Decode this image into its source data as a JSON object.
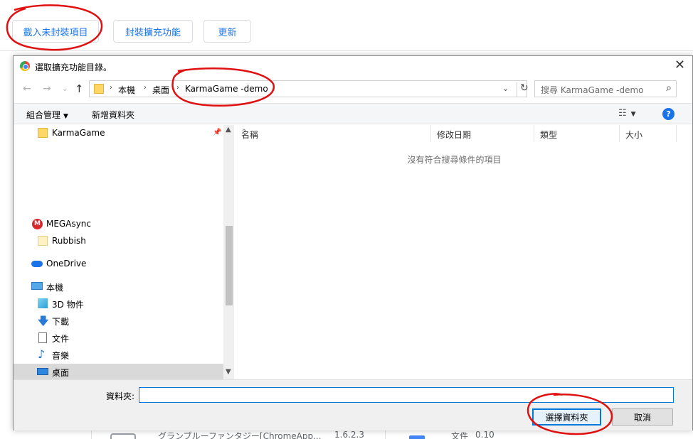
{
  "ext_toolbar": {
    "load_unpacked": "載入未封裝項目",
    "pack_extension": "封裝擴充功能",
    "update": "更新"
  },
  "background": {
    "item_name": "グランブルーファンタジー[ChromeApp...",
    "item_version": "1.6.2.3",
    "item2_name": "文件",
    "item2_version": "0.10"
  },
  "dialog": {
    "title": "選取擴充功能目錄。",
    "close_icon": "close-icon",
    "address": {
      "crumbs": [
        "本機",
        "桌面",
        "KarmaGame -demo"
      ],
      "search_placeholder": "搜尋 KarmaGame -demo"
    },
    "toolbar": {
      "organize": "組合管理",
      "new_folder": "新增資料夾"
    },
    "nav": {
      "items": [
        {
          "label": "KarmaGame",
          "icon": "folder-icon"
        },
        {
          "label": "MEGAsync",
          "icon": "mega-icon"
        },
        {
          "label": "Rubbish",
          "icon": "folder-icon"
        },
        {
          "label": "OneDrive",
          "icon": "onedrive-icon"
        },
        {
          "label": "本機",
          "icon": "computer-icon"
        },
        {
          "label": "3D 物件",
          "icon": "3d-objects-icon"
        },
        {
          "label": "下載",
          "icon": "download-icon"
        },
        {
          "label": "文件",
          "icon": "document-icon"
        },
        {
          "label": "音樂",
          "icon": "music-icon"
        },
        {
          "label": "桌面",
          "icon": "desktop-icon"
        }
      ]
    },
    "file_list": {
      "columns": [
        "名稱",
        "修改日期",
        "類型",
        "大小"
      ],
      "empty_message": "沒有符合搜尋條件的項目"
    },
    "bottom": {
      "folder_label": "資料夾:",
      "folder_value": "",
      "select_button": "選擇資料夾",
      "cancel_button": "取消"
    }
  },
  "colors": {
    "accent": "#1a73e8",
    "annotation": "#e01010",
    "selected_nav": "#d9d9d9"
  }
}
